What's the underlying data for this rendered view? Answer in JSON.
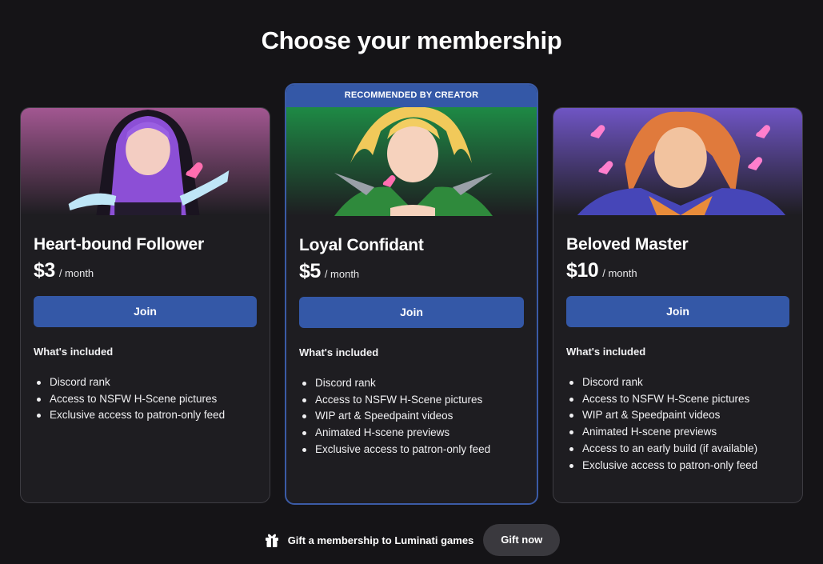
{
  "page": {
    "title": "Choose your membership"
  },
  "tiers": [
    {
      "name": "Heart-bound Follower",
      "price": "$3",
      "period": "/ month",
      "join_label": "Join",
      "included_title": "What's included",
      "benefits": [
        "Discord rank",
        "Access to NSFW H-Scene pictures",
        "Exclusive access to patron-only feed"
      ],
      "art_color": "#a25791"
    },
    {
      "badge": "RECOMMENDED BY CREATOR",
      "name": "Loyal Confidant",
      "price": "$5",
      "period": "/ month",
      "join_label": "Join",
      "included_title": "What's included",
      "benefits": [
        "Discord rank",
        "Access to NSFW H-Scene pictures",
        "WIP art & Speedpaint videos",
        "Animated H-scene previews",
        "Exclusive access to patron-only feed"
      ],
      "art_color": "#1e8a45"
    },
    {
      "name": "Beloved Master",
      "price": "$10",
      "period": "/ month",
      "join_label": "Join",
      "included_title": "What's included",
      "benefits": [
        "Discord rank",
        "Access to NSFW H-Scene pictures",
        "WIP art & Speedpaint videos",
        "Animated H-scene previews",
        "Access to an early build (if available)",
        "Exclusive access to patron-only feed"
      ],
      "art_color": "#6f55c4"
    }
  ],
  "gift": {
    "text": "Gift a membership to Luminati games",
    "button_label": "Gift now"
  },
  "colors": {
    "accent": "#3458a7",
    "background": "#151417",
    "card": "#1e1d21"
  }
}
